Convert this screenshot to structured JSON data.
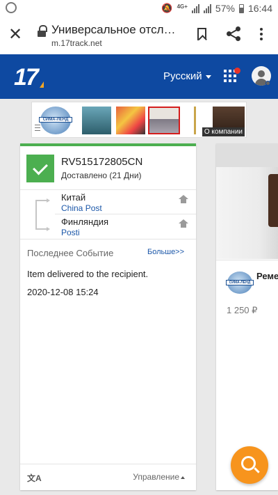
{
  "status_bar": {
    "battery": "57%",
    "time": "16:44",
    "network": "4G+"
  },
  "browser": {
    "title": "Универсальное отслежи...",
    "url": "m.17track.net"
  },
  "header": {
    "logo": "17",
    "language": "Русский"
  },
  "ad": {
    "brand": "СИМА-ЛЕНД",
    "about_label": "О компании"
  },
  "tracking_card": {
    "tracking_number": "RV515172805CN",
    "status": "Доставлено (21 Дни)",
    "origin": {
      "country": "Китай",
      "carrier": "China Post"
    },
    "destination": {
      "country": "Финляндия",
      "carrier": "Posti"
    },
    "last_event_label": "Последнее Событие",
    "more_label": "Больше>>",
    "event_text": "Item delivered to the recipient.",
    "event_time": "2020-12-08 15:24",
    "translate_glyph": "文A",
    "manage_label": "Управление"
  },
  "product_card": {
    "brand": "СИМА-ЛЕНД",
    "title": "Реме",
    "price": "1 250 ₽"
  },
  "colors": {
    "header_bg": "#0e49a1",
    "status_green": "#4caf50",
    "fab_orange": "#f7941d",
    "link_blue": "#1a56a8"
  }
}
